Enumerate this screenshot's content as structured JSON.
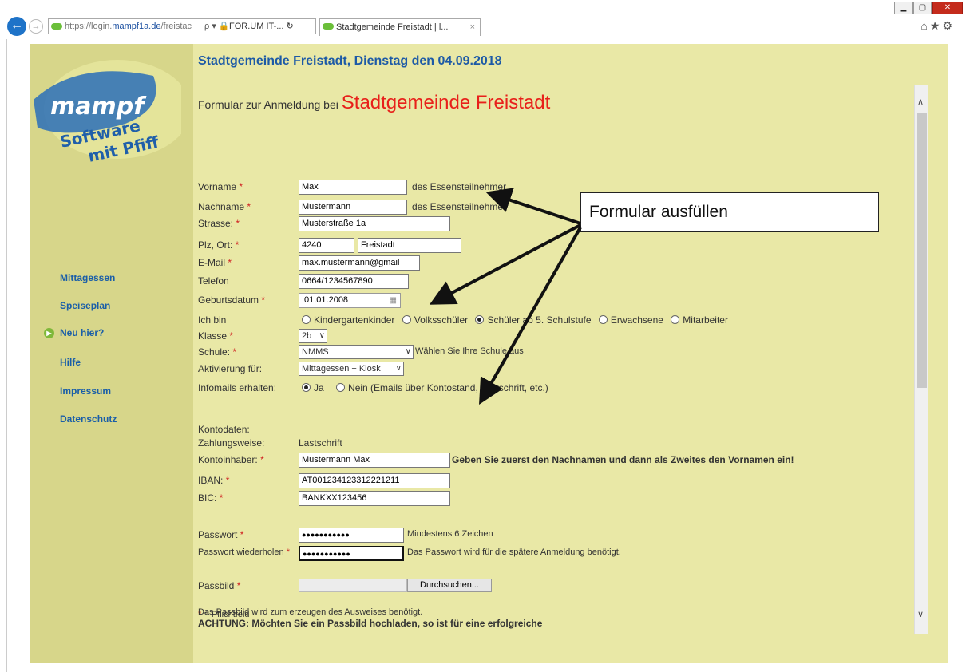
{
  "browser": {
    "url_prefix": "https://login.",
    "url_domain": "mampf1a.de",
    "url_rest": "/freistac",
    "url_icons": "ρ ▾ 🔒",
    "pinned_tab": "FOR.UM IT-... ↻",
    "active_tab": "Stadtgemeinde Freistadt | l...",
    "tab_close": "×"
  },
  "logo": {
    "line1": "mampf",
    "line2": "Software",
    "line3": "mit Pfiff"
  },
  "sidebar": {
    "items": [
      {
        "label": "Mittagessen"
      },
      {
        "label": "Speiseplan"
      },
      {
        "label": "Neu hier?"
      },
      {
        "label": "Hilfe"
      },
      {
        "label": "Impressum"
      },
      {
        "label": "Datenschutz"
      }
    ]
  },
  "page": {
    "title": "Stadtgemeinde Freistadt, Dienstag den 04.09.2018",
    "form_head": "Formular zur Anmeldung bei",
    "form_org": "Stadtgemeinde Freistadt"
  },
  "form": {
    "required_mark": "*",
    "vorname": {
      "label": "Vorname",
      "value": "Max",
      "hint": "des Essensteilnehmer"
    },
    "nachname": {
      "label": "Nachname",
      "value": "Mustermann",
      "hint": "des Essensteilnehmer"
    },
    "strasse": {
      "label": "Strasse:",
      "value": "Musterstraße 1a"
    },
    "plz": {
      "label": "Plz, Ort:",
      "plz_value": "4240",
      "ort_value": "Freistadt"
    },
    "email": {
      "label": "E-Mail",
      "value": "max.mustermann@gmail"
    },
    "telefon": {
      "label": "Telefon",
      "value": "0664/1234567890"
    },
    "geburtsdatum": {
      "label": "Geburtsdatum",
      "value": "01.01.2008"
    },
    "ichbin": {
      "label": "Ich bin",
      "options": [
        {
          "label": "Kindergartenkinder",
          "selected": false
        },
        {
          "label": "Volksschüler",
          "selected": false
        },
        {
          "label": "Schüler ab 5. Schulstufe",
          "selected": true
        },
        {
          "label": "Erwachsene",
          "selected": false
        },
        {
          "label": "Mitarbeiter",
          "selected": false
        }
      ]
    },
    "klasse": {
      "label": "Klasse",
      "value": "2b"
    },
    "schule": {
      "label": "Schule:",
      "value": "NMMS",
      "hint": "Wählen Sie Ihre Schule aus"
    },
    "aktivierung": {
      "label": "Aktivierung für:",
      "value": "Mittagessen + Kiosk"
    },
    "infomails": {
      "label": "Infomails erhalten:",
      "options": [
        {
          "label": "Ja",
          "selected": true
        },
        {
          "label": "Nein (Emails über Kontostand, Lastschrift, etc.)",
          "selected": false
        }
      ]
    },
    "kontodaten": {
      "label": "Kontodaten:"
    },
    "zahlungsweise": {
      "label": "Zahlungsweise:",
      "value": "Lastschrift"
    },
    "kontoinhaber": {
      "label": "Kontoinhaber:",
      "value": "Mustermann Max",
      "hint": "Geben Sie zuerst den Nachnamen und dann als Zweites den Vornamen ein!"
    },
    "iban": {
      "label": "IBAN:",
      "value": "AT001234123312221211"
    },
    "bic": {
      "label": "BIC:",
      "value": "BANKXX123456"
    },
    "passwort": {
      "label": "Passwort",
      "value": "●●●●●●●●●●●",
      "hint": "Mindestens 6 Zeichen"
    },
    "passwort2": {
      "label": "Passwort wiederholen",
      "value": "●●●●●●●●●●●",
      "hint": "Das Passwort wird für die spätere Anmeldung benötigt."
    },
    "passbild": {
      "label": "Passbild",
      "button": "Durchsuchen..."
    },
    "pflicht": "= Pflichtfeld",
    "note1": "Das Passbild wird zum erzeugen des Ausweises benötigt.",
    "note2": "ACHTUNG: Möchten Sie ein Passbild hochladen, so ist für eine erfolgreiche"
  },
  "annotation": {
    "text": "Formular ausfüllen"
  }
}
